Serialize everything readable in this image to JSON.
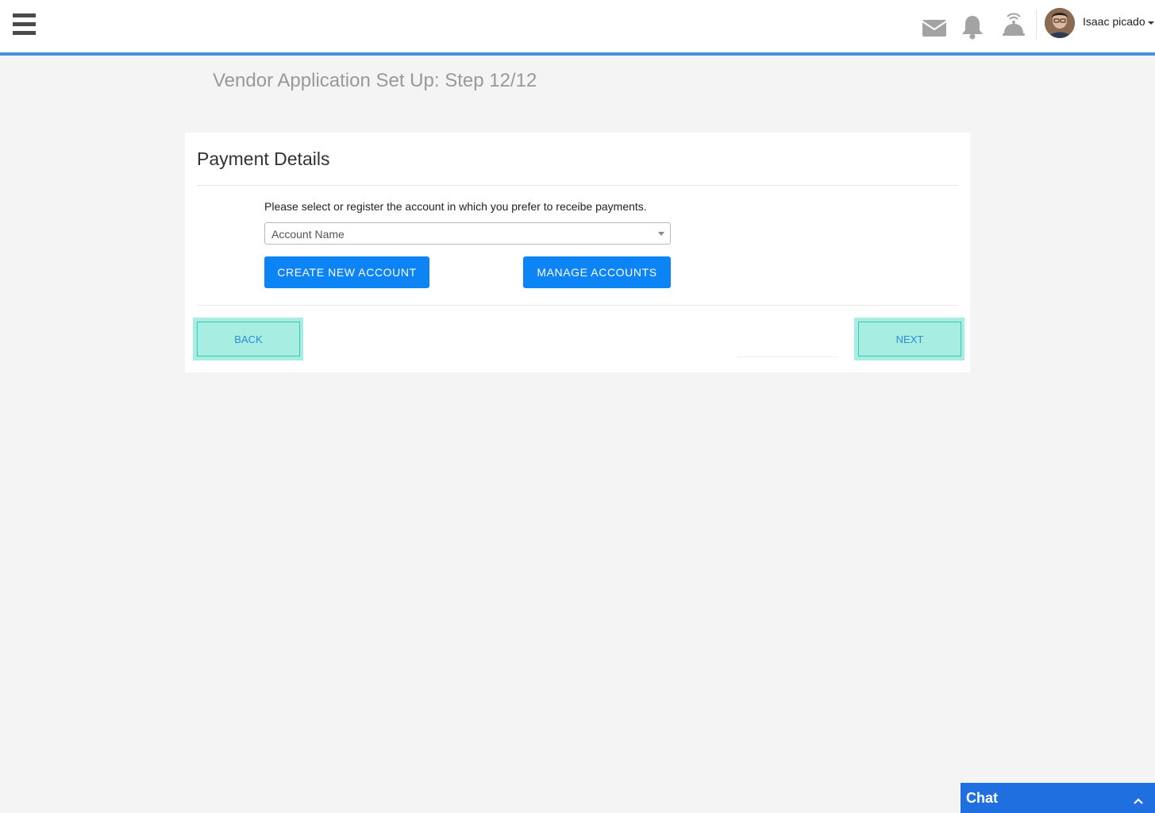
{
  "header": {
    "menu_icon": "hamburger-icon",
    "icons": [
      "mail-icon",
      "bell-icon",
      "service-bell-icon"
    ],
    "user_name": "Isaac picado",
    "accent_color": "#4a90e2"
  },
  "page": {
    "title": "Vendor Application Set Up: Step 12/12"
  },
  "card": {
    "title": "Payment Details",
    "instruction": "Please select or register the account in which you prefer to receibe payments.",
    "select_placeholder": "Account Name",
    "create_button": "CREATE NEW ACCOUNT",
    "manage_button": "MANAGE ACCOUNTS",
    "back_button": "BACK",
    "next_button": "NEXT",
    "primary_color": "#0d84f5",
    "nav_button_color": "#a8ede2"
  },
  "chat": {
    "label": "Chat",
    "color": "#1f6fe0"
  }
}
